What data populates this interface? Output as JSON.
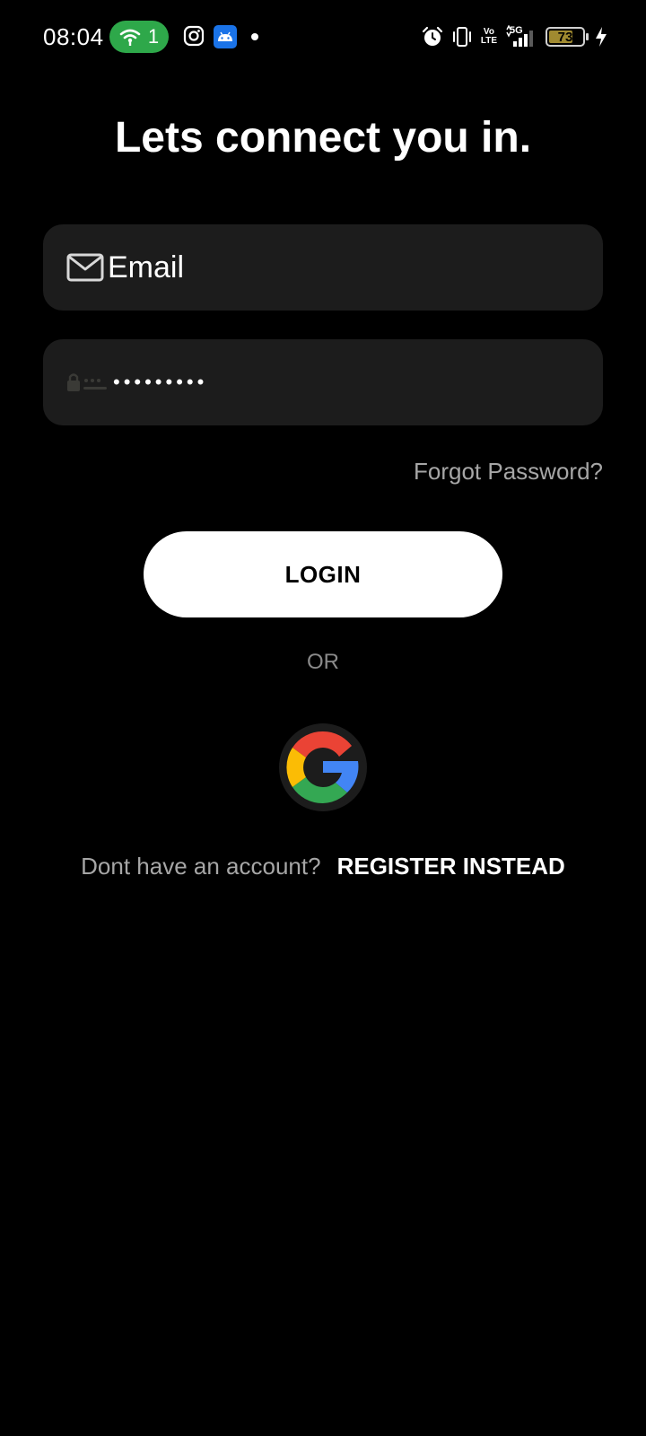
{
  "status_bar": {
    "time": "08:04",
    "hotspot_count": "1",
    "battery_level": "73",
    "battery_fraction": 0.73,
    "network_label": "5G",
    "volte_top": "Vo",
    "volte_bottom": "LTE",
    "icons": [
      "hotspot-icon",
      "instagram-icon",
      "android-app-icon",
      "notification-dot-icon",
      "alarm-icon",
      "vibrate-icon",
      "volte-icon",
      "signal-5g-icon",
      "battery-icon",
      "charging-icon"
    ]
  },
  "login": {
    "title": "Lets connect you in.",
    "email": {
      "placeholder": "Email",
      "icon": "mail-icon"
    },
    "password": {
      "value": "•••••••••",
      "icon": "password-icon"
    },
    "forgot_password": "Forgot Password?",
    "login_button": "LOGIN",
    "or_label": "OR",
    "google_button_icon": "google-icon",
    "register_prompt": "Dont have an account?",
    "register_link": "REGISTER INSTEAD"
  },
  "colors": {
    "background": "#000000",
    "field_background": "#1c1c1c",
    "muted_text": "#a6a6a6",
    "hotspot_green": "#2ea84a",
    "google_red": "#ea4335",
    "google_yellow": "#fbbc05",
    "google_green": "#34a853",
    "google_blue": "#4285f4"
  }
}
